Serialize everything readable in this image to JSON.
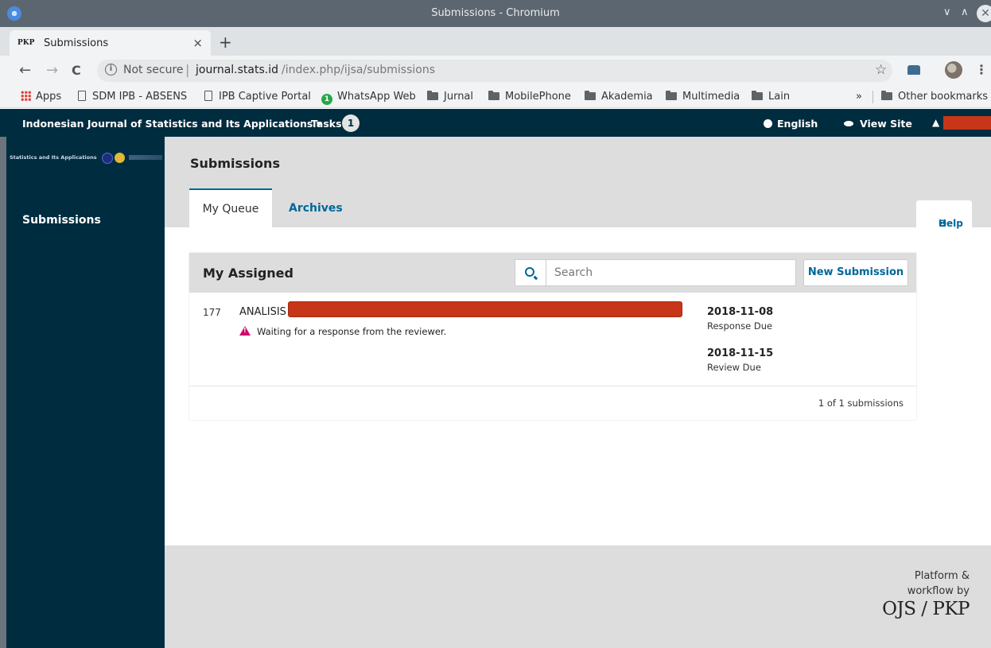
{
  "window": {
    "title": "Submissions - Chromium",
    "min": "∨",
    "max": "∧",
    "close": "✕"
  },
  "tab": {
    "favicon": "PKP",
    "title": "Submissions",
    "close": "×",
    "new": "+"
  },
  "nav": {
    "back": "←",
    "forward": "→",
    "reload": "C",
    "info": "i"
  },
  "address": {
    "security": "Not secure",
    "separator": "|",
    "host": "journal.stats.id",
    "path": "/index.php/ijsa/submissions"
  },
  "toolbar": {
    "star": "☆",
    "menu": "⋮"
  },
  "bookmarks": {
    "apps": "Apps",
    "items": [
      "SDM IPB - ABSENS",
      "IPB Captive Portal",
      "WhatsApp Web",
      "Jurnal",
      "MobilePhone",
      "Akademia",
      "Multimedia",
      "Lain"
    ],
    "wa_badge": "1",
    "overflow": "»",
    "other": "Other bookmarks"
  },
  "appnav": {
    "journal": "Indonesian Journal of Statistics and Its Applications ▾",
    "tasks": "Tasks",
    "tasks_count": "1",
    "language": "English",
    "view_site": "View Site",
    "user_icon": "▲"
  },
  "sidebar": {
    "logo_text": "Statistics and Its Applications",
    "items": [
      {
        "label": "Submissions"
      }
    ]
  },
  "main": {
    "title": "Submissions",
    "tabs": [
      {
        "label": "My Queue"
      },
      {
        "label": "Archives"
      }
    ],
    "help": "Help",
    "help_icon": "❶",
    "panel": {
      "title": "My Assigned",
      "search_placeholder": "Search",
      "new_submission": "New Submission",
      "rows": [
        {
          "id": "177",
          "title": "ANALISIS",
          "status": "Waiting for a response from the reviewer.",
          "response_due_date": "2018-11-08",
          "response_due_label": "Response Due",
          "review_due_date": "2018-11-15",
          "review_due_label": "Review Due"
        }
      ],
      "count": "1 of 1 submissions"
    },
    "footer": {
      "line1": "Platform &",
      "line2": "workflow by",
      "brand": "OJS / PKP"
    }
  },
  "colors": {
    "nav_bg": "#002c40",
    "link": "#006798",
    "warning": "#d00a6c",
    "redaction": "#c73619"
  }
}
